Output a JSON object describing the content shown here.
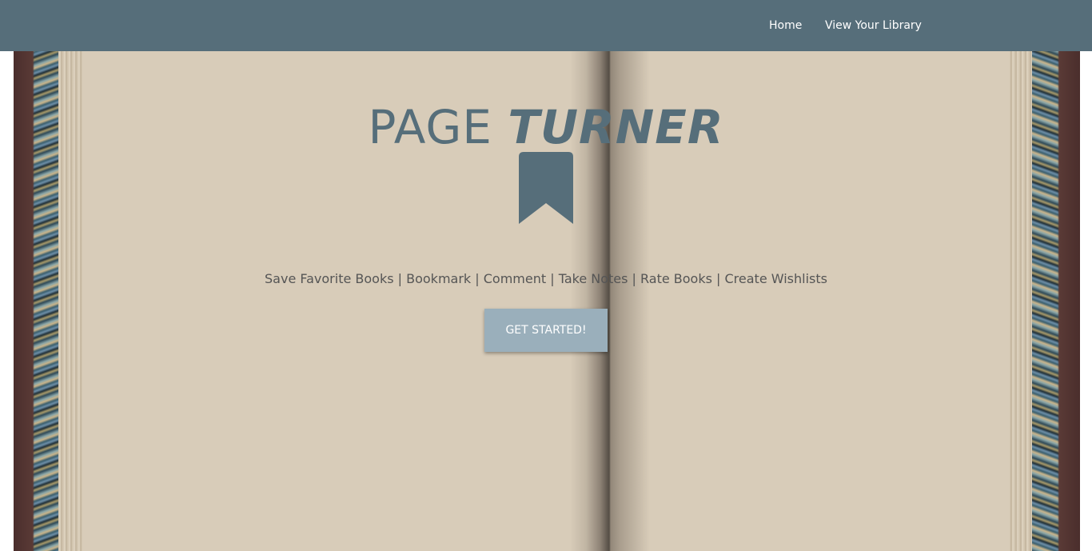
{
  "nav": {
    "home_label": "Home",
    "library_label": "View Your Library"
  },
  "hero": {
    "title_part1": "PAGE ",
    "title_part2": "TURNER",
    "features": "Save Favorite Books | Bookmark | Comment | Take Notes | Rate Books | Create Wishlists",
    "cta_label": "GET STARTED!"
  },
  "icons": {
    "logo": "bookmark-icon"
  },
  "colors": {
    "navbar": "#566e7a",
    "title": "#566e7a",
    "page": "#d8ccb9",
    "button": "#9aafbb"
  }
}
